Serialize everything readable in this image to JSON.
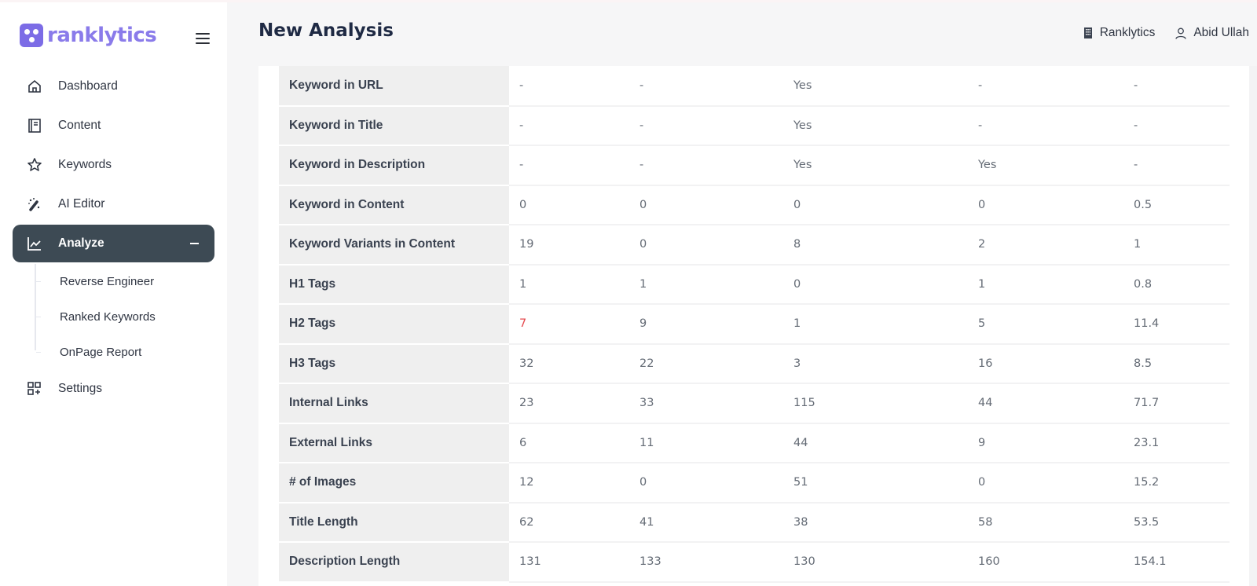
{
  "app": {
    "logo_text": "ranklytics",
    "brand_color": "#7c6ce6"
  },
  "sidebar": {
    "items": [
      {
        "label": "Dashboard",
        "icon": "home-icon"
      },
      {
        "label": "Content",
        "icon": "notebook-icon"
      },
      {
        "label": "Keywords",
        "icon": "star-icon"
      },
      {
        "label": "AI Editor",
        "icon": "magic-wand-icon"
      },
      {
        "label": "Analyze",
        "icon": "chart-line-icon",
        "active": true,
        "expanded": true
      },
      {
        "label": "Settings",
        "icon": "grid-plus-icon"
      }
    ],
    "submenu": [
      {
        "label": "Reverse Engineer"
      },
      {
        "label": "Ranked Keywords"
      },
      {
        "label": "OnPage Report"
      }
    ],
    "active_color": "#3d4a54"
  },
  "header": {
    "title": "New Analysis",
    "workspace": "Ranklytics",
    "user": "Abid Ullah"
  },
  "table": {
    "rows": [
      {
        "label": "Keyword in URL",
        "values": [
          "-",
          "-",
          "Yes",
          "-",
          "-"
        ]
      },
      {
        "label": "Keyword in Title",
        "values": [
          "-",
          "-",
          "Yes",
          "-",
          "-"
        ]
      },
      {
        "label": "Keyword in Description",
        "values": [
          "-",
          "-",
          "Yes",
          "Yes",
          "-"
        ]
      },
      {
        "label": "Keyword in Content",
        "values": [
          "0",
          "0",
          "0",
          "0",
          "0.5"
        ]
      },
      {
        "label": "Keyword Variants in Content",
        "values": [
          "19",
          "0",
          "8",
          "2",
          "1"
        ]
      },
      {
        "label": "H1 Tags",
        "values": [
          "1",
          "1",
          "0",
          "1",
          "0.8"
        ]
      },
      {
        "label": "H2 Tags",
        "values": [
          "7",
          "9",
          "1",
          "5",
          "11.4"
        ],
        "highlight_first": true
      },
      {
        "label": "H3 Tags",
        "values": [
          "32",
          "22",
          "3",
          "16",
          "8.5"
        ]
      },
      {
        "label": "Internal Links",
        "values": [
          "23",
          "33",
          "115",
          "44",
          "71.7"
        ]
      },
      {
        "label": "External Links",
        "values": [
          "6",
          "11",
          "44",
          "9",
          "23.1"
        ]
      },
      {
        "label": "# of Images",
        "values": [
          "12",
          "0",
          "51",
          "0",
          "15.2"
        ]
      },
      {
        "label": "Title Length",
        "values": [
          "62",
          "41",
          "38",
          "58",
          "53.5"
        ]
      },
      {
        "label": "Description Length",
        "values": [
          "131",
          "133",
          "130",
          "160",
          "154.1"
        ]
      }
    ],
    "highlight_color": "#e5484d"
  }
}
